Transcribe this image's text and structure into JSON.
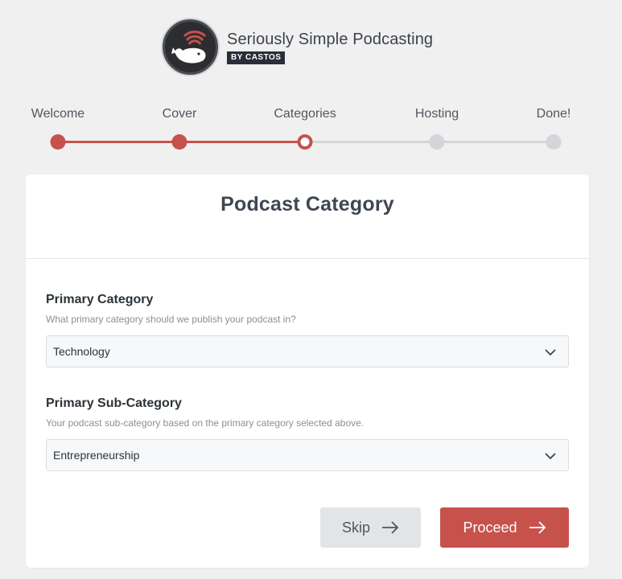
{
  "brand": {
    "title": "Seriously Simple Podcasting",
    "badge": "BY CASTOS",
    "logo_icon": "whale-podcast-logo-icon"
  },
  "stepper": {
    "steps": [
      {
        "label": "Welcome",
        "state": "done"
      },
      {
        "label": "Cover",
        "state": "done"
      },
      {
        "label": "Categories",
        "state": "current"
      },
      {
        "label": "Hosting",
        "state": "todo"
      },
      {
        "label": "Done!",
        "state": "todo"
      }
    ]
  },
  "card": {
    "title": "Podcast Category",
    "primary": {
      "label": "Primary Category",
      "help": "What primary category should we publish your podcast in?",
      "value": "Technology"
    },
    "sub": {
      "label": "Primary Sub-Category",
      "help": "Your podcast sub-category based on the primary category selected above.",
      "value": "Entrepreneurship"
    },
    "skip_label": "Skip",
    "proceed_label": "Proceed"
  },
  "colors": {
    "accent": "#c6524b",
    "inactive": "#d4d5d9",
    "background": "#f0f0f1"
  }
}
